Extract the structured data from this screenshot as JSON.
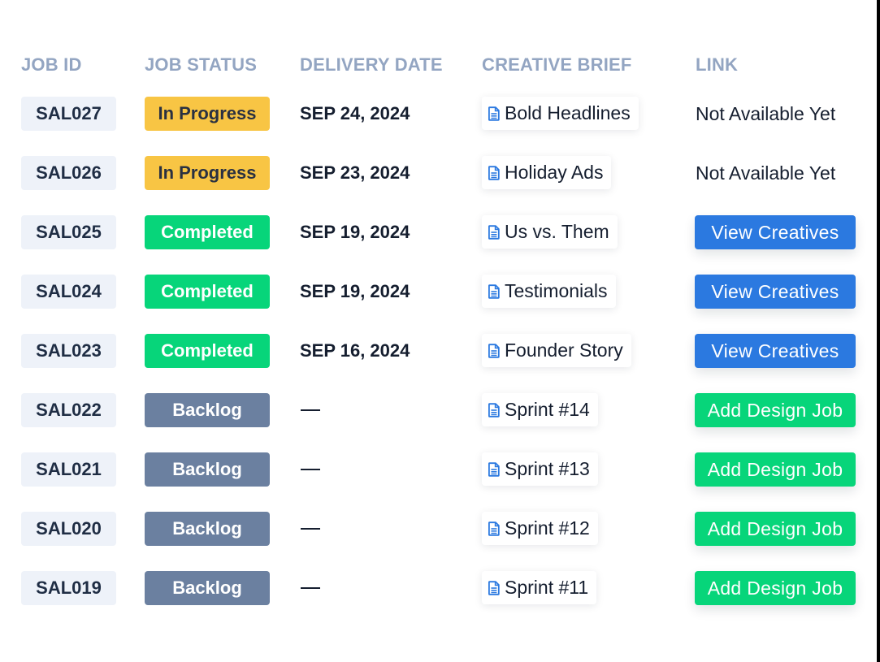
{
  "colors": {
    "header_text": "#93a5c2",
    "job_id_bg": "#eef2f9",
    "in_progress": "#f8c544",
    "completed": "#07d57a",
    "backlog": "#6b80a0",
    "view_button": "#2b79e0",
    "add_button": "#07d57a",
    "doc_icon": "#2b79e0",
    "text_dark": "#151e2f"
  },
  "table": {
    "headers": {
      "job_id": "JOB ID",
      "job_status": "JOB STATUS",
      "delivery_date": "DELIVERY DATE",
      "creative_brief": "CREATIVE BRIEF",
      "link": "LINK"
    },
    "rows": [
      {
        "job_id": "SAL027",
        "status": "In Progress",
        "status_kind": "in-progress",
        "delivery_date": "SEP 24, 2024",
        "brief_icon": "document-icon",
        "brief": "Bold Headlines",
        "link_kind": "text",
        "link": "Not Available Yet"
      },
      {
        "job_id": "SAL026",
        "status": "In Progress",
        "status_kind": "in-progress",
        "delivery_date": "SEP 23, 2024",
        "brief_icon": "document-icon",
        "brief": "Holiday Ads",
        "link_kind": "text",
        "link": "Not Available Yet"
      },
      {
        "job_id": "SAL025",
        "status": "Completed",
        "status_kind": "completed",
        "delivery_date": "SEP 19, 2024",
        "brief_icon": "document-icon",
        "brief": "Us vs. Them",
        "link_kind": "view",
        "link": "View Creatives"
      },
      {
        "job_id": "SAL024",
        "status": "Completed",
        "status_kind": "completed",
        "delivery_date": "SEP 19, 2024",
        "brief_icon": "document-icon",
        "brief": "Testimonials",
        "link_kind": "view",
        "link": "View Creatives"
      },
      {
        "job_id": "SAL023",
        "status": "Completed",
        "status_kind": "completed",
        "delivery_date": "SEP 16, 2024",
        "brief_icon": "document-icon",
        "brief": "Founder Story",
        "link_kind": "view",
        "link": "View Creatives"
      },
      {
        "job_id": "SAL022",
        "status": "Backlog",
        "status_kind": "backlog",
        "delivery_date": "—",
        "brief_icon": "document-icon",
        "brief": "Sprint #14",
        "link_kind": "add",
        "link": "Add Design Job"
      },
      {
        "job_id": "SAL021",
        "status": "Backlog",
        "status_kind": "backlog",
        "delivery_date": "—",
        "brief_icon": "document-icon",
        "brief": "Sprint #13",
        "link_kind": "add",
        "link": "Add Design Job"
      },
      {
        "job_id": "SAL020",
        "status": "Backlog",
        "status_kind": "backlog",
        "delivery_date": "—",
        "brief_icon": "document-icon",
        "brief": "Sprint #12",
        "link_kind": "add",
        "link": "Add Design Job"
      },
      {
        "job_id": "SAL019",
        "status": "Backlog",
        "status_kind": "backlog",
        "delivery_date": "—",
        "brief_icon": "document-icon",
        "brief": "Sprint #11",
        "link_kind": "add",
        "link": "Add Design Job"
      }
    ]
  }
}
